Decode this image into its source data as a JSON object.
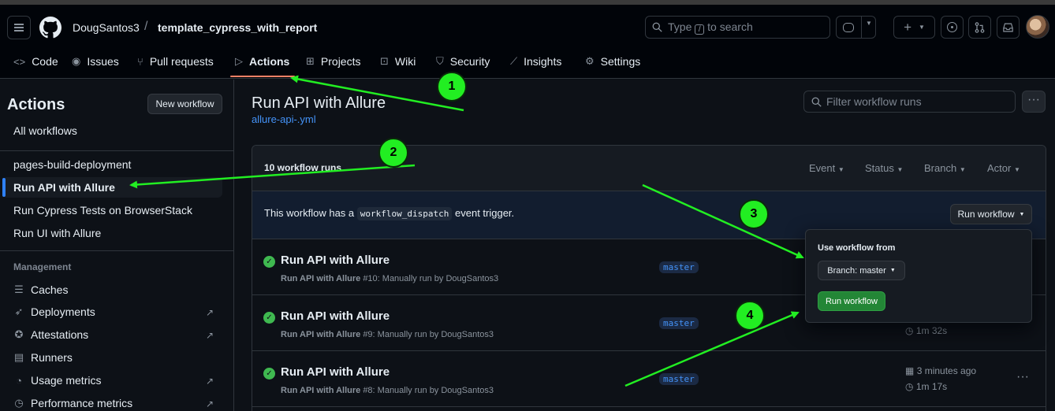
{
  "header": {
    "owner": "DougSantos3",
    "separator": "/",
    "repo": "template_cypress_with_report",
    "search_prefix": "Type",
    "search_key": "/",
    "search_suffix": "to search",
    "plus": "+"
  },
  "repo_nav": {
    "items": [
      {
        "label": "Code",
        "icon": "code-icon"
      },
      {
        "label": "Issues",
        "icon": "issue-icon"
      },
      {
        "label": "Pull requests",
        "icon": "pull-request-icon"
      },
      {
        "label": "Actions",
        "icon": "play-icon",
        "active": true
      },
      {
        "label": "Projects",
        "icon": "table-icon"
      },
      {
        "label": "Wiki",
        "icon": "book-icon"
      },
      {
        "label": "Security",
        "icon": "shield-icon"
      },
      {
        "label": "Insights",
        "icon": "graph-icon"
      },
      {
        "label": "Settings",
        "icon": "gear-icon"
      }
    ]
  },
  "sidebar": {
    "title": "Actions",
    "new_workflow": "New workflow",
    "all_workflows": "All workflows",
    "workflows": [
      "pages-build-deployment",
      "Run API with Allure",
      "Run Cypress Tests on BrowserStack",
      "Run UI with Allure"
    ],
    "management_heading": "Management",
    "management": [
      {
        "label": "Caches",
        "icon": "cache-icon"
      },
      {
        "label": "Deployments",
        "icon": "rocket-icon"
      },
      {
        "label": "Attestations",
        "icon": "verified-icon"
      },
      {
        "label": "Runners",
        "icon": "server-icon"
      },
      {
        "label": "Usage metrics",
        "icon": "meter-icon"
      },
      {
        "label": "Performance metrics",
        "icon": "stopwatch-icon"
      }
    ]
  },
  "main": {
    "title": "Run API with Allure",
    "file_link": "allure-api-.yml",
    "filter_placeholder": "Filter workflow runs",
    "runs_count": "10 workflow runs",
    "filters": [
      "Event",
      "Status",
      "Branch",
      "Actor"
    ],
    "dispatch_before": "This workflow has a",
    "dispatch_code": "workflow_dispatch",
    "dispatch_after": "event trigger.",
    "run_workflow_button": "Run workflow",
    "runs": [
      {
        "title": "Run API with Allure",
        "workflow": "Run API with Allure",
        "detail": "#10: Manually run by DougSantos3",
        "branch": "master",
        "time_ago": "",
        "duration": ""
      },
      {
        "title": "Run API with Allure",
        "workflow": "Run API with Allure",
        "detail": "#9: Manually run by DougSantos3",
        "branch": "master",
        "time_ago": "",
        "duration": "1m 32s"
      },
      {
        "title": "Run API with Allure",
        "workflow": "Run API with Allure",
        "detail": "#8: Manually run by DougSantos3",
        "branch": "master",
        "time_ago": "3 minutes ago",
        "duration": "1m 17s"
      }
    ]
  },
  "popup": {
    "title": "Use workflow from",
    "branch_select": "Branch: master",
    "run_button": "Run workflow"
  },
  "annotations": [
    "1",
    "2",
    "3",
    "4"
  ],
  "colors": {
    "accent": "#f78166",
    "success": "#3fb950",
    "link": "#4493f8",
    "annotation": "#22ee22"
  }
}
